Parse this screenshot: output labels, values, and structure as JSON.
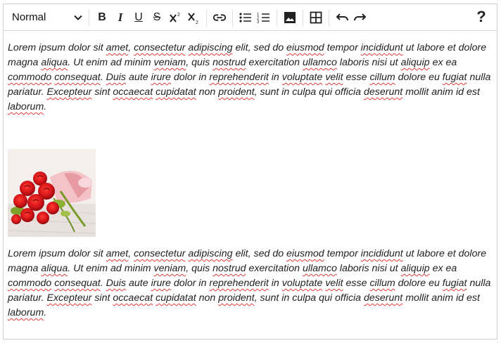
{
  "toolbar": {
    "format_value": "Normal",
    "buttons": [
      {
        "name": "bold-button",
        "icon": "bold-icon"
      },
      {
        "name": "italic-button",
        "icon": "italic-icon"
      },
      {
        "name": "underline-button",
        "icon": "underline-icon"
      },
      {
        "name": "strikethrough-button",
        "icon": "strikethrough-icon"
      },
      {
        "name": "superscript-button",
        "icon": "superscript-icon"
      },
      {
        "name": "subscript-button",
        "icon": "subscript-icon"
      },
      {
        "name": "link-button",
        "icon": "link-icon"
      },
      {
        "name": "bullet-list-button",
        "icon": "bullet-list-icon"
      },
      {
        "name": "numbered-list-button",
        "icon": "numbered-list-icon"
      },
      {
        "name": "insert-image-button",
        "icon": "image-icon"
      },
      {
        "name": "insert-table-button",
        "icon": "table-icon"
      },
      {
        "name": "undo-button",
        "icon": "undo-icon"
      },
      {
        "name": "redo-button",
        "icon": "redo-icon"
      }
    ],
    "help_label": "?"
  },
  "content": {
    "paragraphs": [
      "Lorem ipsum dolor sit amet, consectetur adipiscing elit, sed do eiusmod tempor incididunt ut labore et dolore magna aliqua. Ut enim ad minim veniam, quis nostrud exercitation ullamco laboris nisi ut aliquip ex ea commodo consequat. Duis aute irure dolor in reprehenderit in voluptate velit esse cillum dolore eu fugiat nulla pariatur. Excepteur sint occaecat cupidatat non proident, sunt in culpa qui officia deserunt mollit anim id est laborum.",
      "Lorem ipsum dolor sit amet, consectetur adipiscing elit, sed do eiusmod tempor incididunt ut labore et dolore magna aliqua. Ut enim ad minim veniam, quis nostrud exercitation ullamco laboris nisi ut aliquip ex ea commodo consequat. Duis aute irure dolor in reprehenderit in voluptate velit esse cillum dolore eu fugiat nulla pariatur. Excepteur sint occaecat cupidatat non proident, sunt in culpa qui officia deserunt mollit anim id est laborum."
    ],
    "misspelled_words": [
      "amet",
      "consectetur",
      "adipiscing",
      "eiusmod",
      "incididunt",
      "aliqua",
      "veniam",
      "nostrud",
      "ullamco",
      "aliquip",
      "commodo",
      "consequat",
      "Duis",
      "irure",
      "reprehenderit",
      "voluptate",
      "velit",
      "cillum",
      "fugiat",
      "Excepteur",
      "occaecat",
      "cupidatat",
      "proident",
      "deserunt",
      "laborum"
    ],
    "image_subject": "bouquet of red roses"
  },
  "colors": {
    "spellcheck_underline": "#e23b3b",
    "rose_red": "#d8151a",
    "border": "#cfcfcf"
  }
}
